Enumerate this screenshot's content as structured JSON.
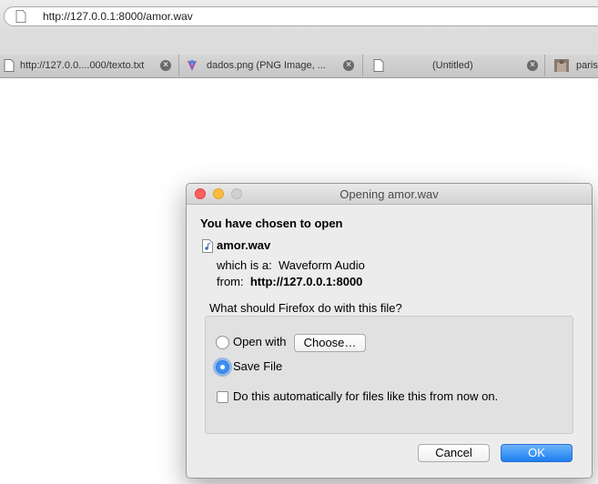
{
  "browser": {
    "url": "http://127.0.0.1:8000/amor.wav",
    "tabs": [
      {
        "label": "http://127.0.0....000/texto.txt",
        "icon": "page-icon"
      },
      {
        "label": "dados.png (PNG Image, ...",
        "icon": "image-favicon-icon"
      },
      {
        "label": "(Untitled)",
        "icon": "page-icon"
      },
      {
        "label": "paris",
        "icon": "photo-thumbnail-icon"
      }
    ]
  },
  "dialog": {
    "title": "Opening amor.wav",
    "heading": "You have chosen to open",
    "file_name": "amor.wav",
    "which_label": "which is a:",
    "which_value": "Waveform Audio",
    "from_label": "from:",
    "from_value": "http://127.0.0.1:8000",
    "question": "What should Firefox do with this file?",
    "open_with_label": "Open with",
    "choose_label": "Choose…",
    "save_file_label": "Save File",
    "auto_label": "Do this automatically for files like this from now on.",
    "selected_option": "save_file",
    "auto_checked": false,
    "cancel_label": "Cancel",
    "ok_label": "OK"
  },
  "colors": {
    "accent": "#1c7ff0",
    "close": "#fc615d",
    "minimize": "#fdbc40"
  }
}
